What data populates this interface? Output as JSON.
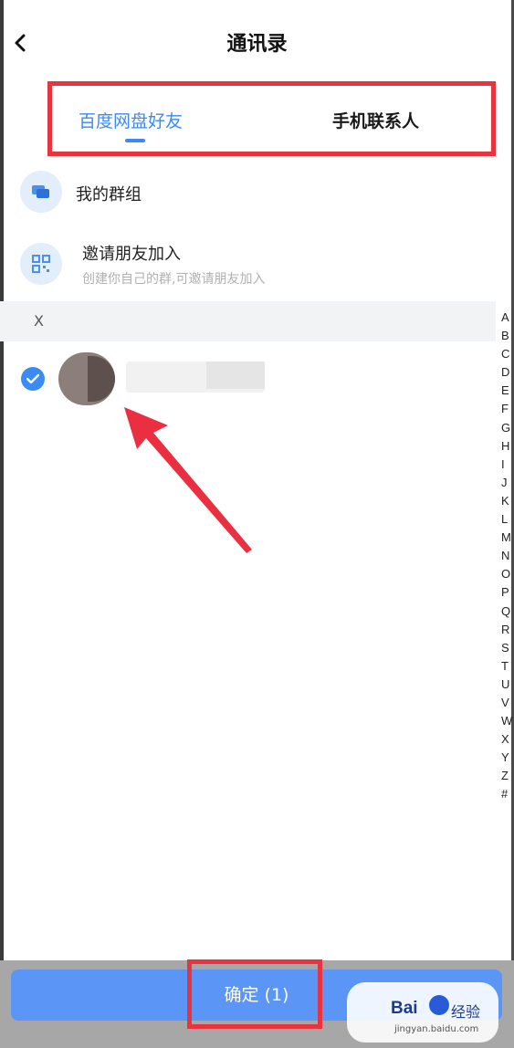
{
  "header": {
    "title": "通讯录",
    "back_icon": "chevron-left-icon"
  },
  "tabs": [
    {
      "label": "百度网盘好友",
      "active": true
    },
    {
      "label": "手机联系人",
      "active": false
    }
  ],
  "rows": {
    "groups": {
      "title": "我的群组",
      "icon": "chat-bubbles-icon"
    },
    "invite": {
      "title": "邀请朋友加入",
      "subtitle": "创建你自己的群,可邀请朋友加入",
      "icon": "qr-code-icon"
    }
  },
  "section": {
    "letter": "X"
  },
  "contact": {
    "selected": true
  },
  "alphabet": [
    "A",
    "B",
    "C",
    "D",
    "E",
    "F",
    "G",
    "H",
    "I",
    "J",
    "K",
    "L",
    "M",
    "N",
    "O",
    "P",
    "Q",
    "R",
    "S",
    "T",
    "U",
    "V",
    "W",
    "X",
    "Y",
    "Z",
    "#"
  ],
  "confirm": {
    "label": "确定 (1)"
  },
  "watermark": {
    "logo": "Bai",
    "text": "经验",
    "url": "jingyan.baidu.com"
  },
  "colors": {
    "accent": "#3b8af5",
    "highlight": "#e8343f",
    "button": "#5b95f6"
  }
}
